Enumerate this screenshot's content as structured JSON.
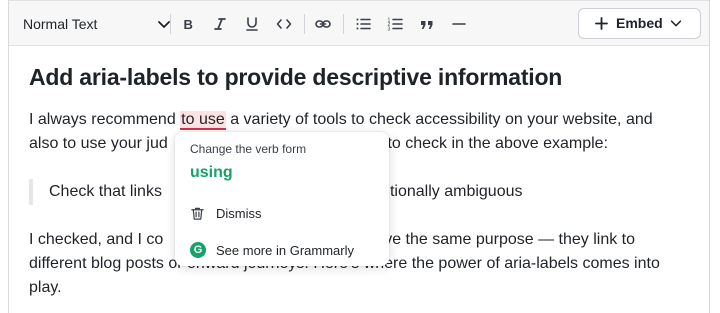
{
  "toolbar": {
    "text_style": "Normal Text",
    "icons": [
      "bold-icon",
      "italic-icon",
      "underline-icon",
      "code-icon",
      "link-icon",
      "bullet-list-icon",
      "numbered-list-icon",
      "quote-icon",
      "divider-icon"
    ],
    "embed_label": "Embed"
  },
  "document": {
    "heading": "Add aria-labels to provide descriptive information",
    "para1_line1_before": "I always recommend ",
    "para1_highlight": "to use",
    "para1_line1_after": " a variety of tools to check accessibility on your website, and",
    "para1_line2_left": "also to use your jud",
    "para1_line2_right": "gests to check in the above example:",
    "quote_left": "Check that links",
    "quote_right": "e intentionally ambiguous",
    "para2_line1_left": "I checked, and I co",
    "para2_line1_right": "ave the same purpose — they link to",
    "para2_line2": "different blog posts or onward journeys. Here’s where the power of aria-labels comes into",
    "para2_line3": "play."
  },
  "popup": {
    "caption": "Change the verb form",
    "suggestion": "using",
    "dismiss": "Dismiss",
    "see_more": "See more in Grammarly",
    "logo_letter": "G"
  },
  "colors": {
    "accent_green": "#15a36a",
    "error_underline": "#d0344a",
    "highlight_bg": "#fbe3e4"
  }
}
